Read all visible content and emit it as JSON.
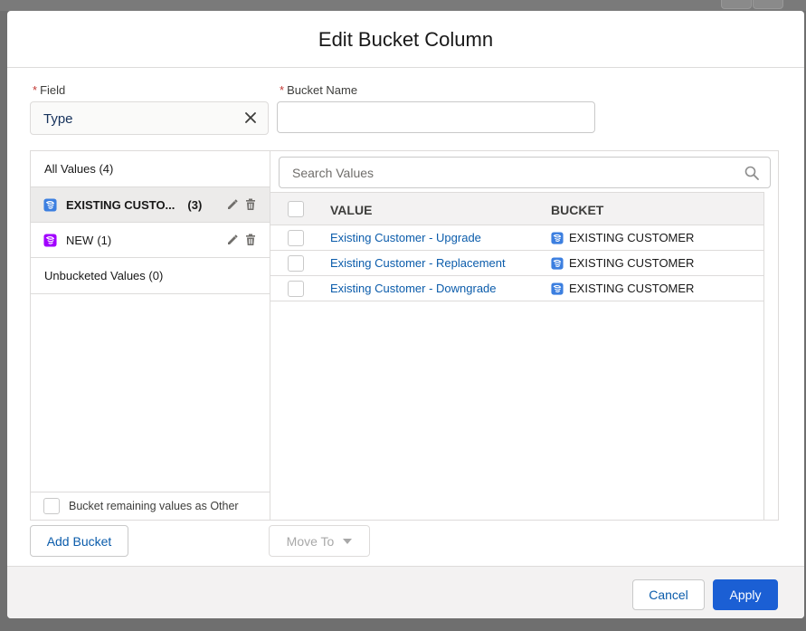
{
  "modal": {
    "title": "Edit Bucket Column"
  },
  "field": {
    "label": "Field",
    "required_mark": "*",
    "value": "Type"
  },
  "bucket_name": {
    "label": "Bucket Name",
    "required_mark": "*",
    "value": ""
  },
  "left_panel": {
    "all_values": "All Values (4)",
    "buckets": [
      {
        "name": "EXISTING CUSTO...",
        "count": "(3)",
        "color": "#3c7fe0",
        "selected": true
      },
      {
        "name": "NEW",
        "count": "(1)",
        "color": "#a100ff",
        "selected": false
      }
    ],
    "unbucketed": "Unbucketed Values (0)",
    "other_checkbox_label": "Bucket remaining values as Other"
  },
  "search": {
    "placeholder": "Search Values"
  },
  "table": {
    "headers": {
      "value": "VALUE",
      "bucket": "BUCKET"
    },
    "rows": [
      {
        "value": "Existing Customer - Upgrade",
        "bucket": "EXISTING CUSTOMER"
      },
      {
        "value": "Existing Customer - Replacement",
        "bucket": "EXISTING CUSTOMER"
      },
      {
        "value": "Existing Customer - Downgrade",
        "bucket": "EXISTING CUSTOMER"
      }
    ]
  },
  "buttons": {
    "add_bucket": "Add Bucket",
    "move_to": "Move To",
    "cancel": "Cancel",
    "apply": "Apply"
  },
  "colors": {
    "brand": "#1b5fd4",
    "link": "#0b5cab",
    "required": "#c23934"
  }
}
